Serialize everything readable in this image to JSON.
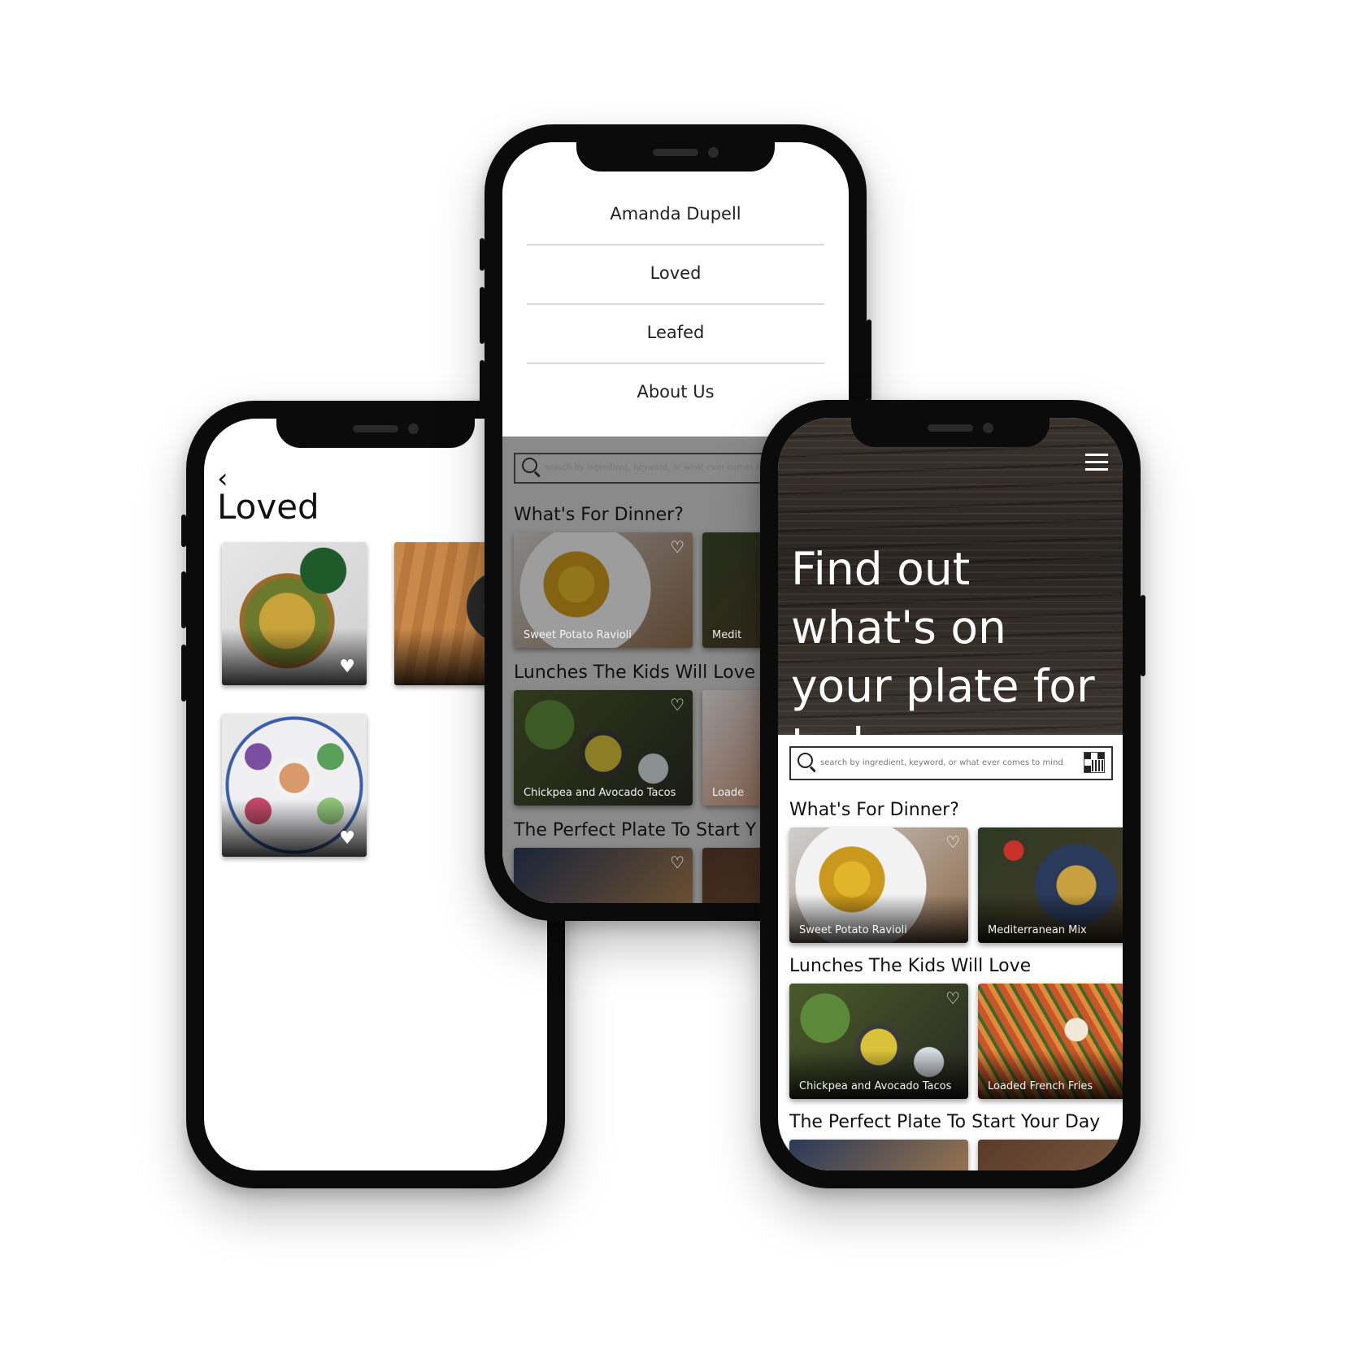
{
  "colors": {
    "menu_overlay": "#8a8a8a",
    "hero_wood": "#2c2622",
    "phone_frame": "#0b0b0b"
  },
  "loved_screen": {
    "back_icon": "chevron-left-icon",
    "title": "Loved"
  },
  "menu_screen": {
    "items": [
      "Amanda Dupell",
      "Loved",
      "Leafed",
      "About Us"
    ],
    "search_placeholder": "search by ingredient, keyword, or what ever comes to",
    "sections": [
      {
        "title": "What's For Dinner?",
        "cards": [
          "Sweet Potato Ravioli",
          "Medit"
        ]
      },
      {
        "title": "Lunches The Kids Will Love",
        "cards": [
          "Chickpea and Avocado Tacos",
          "Loade"
        ]
      },
      {
        "title": "The Perfect Plate To Start Y",
        "cards": []
      }
    ]
  },
  "home_screen": {
    "hero_title": "Find out what's on your plate for today.",
    "search_placeholder": "search by ingredient, keyword, or what ever comes to mind...",
    "sections": [
      {
        "title": "What's For Dinner?",
        "cards": [
          "Sweet Potato Ravioli",
          "Mediterranean Mix"
        ]
      },
      {
        "title": "Lunches The Kids Will Love",
        "cards": [
          "Chickpea and Avocado Tacos",
          "Loaded French Fries"
        ]
      },
      {
        "title": "The Perfect Plate To Start Your Day",
        "cards": []
      }
    ]
  }
}
